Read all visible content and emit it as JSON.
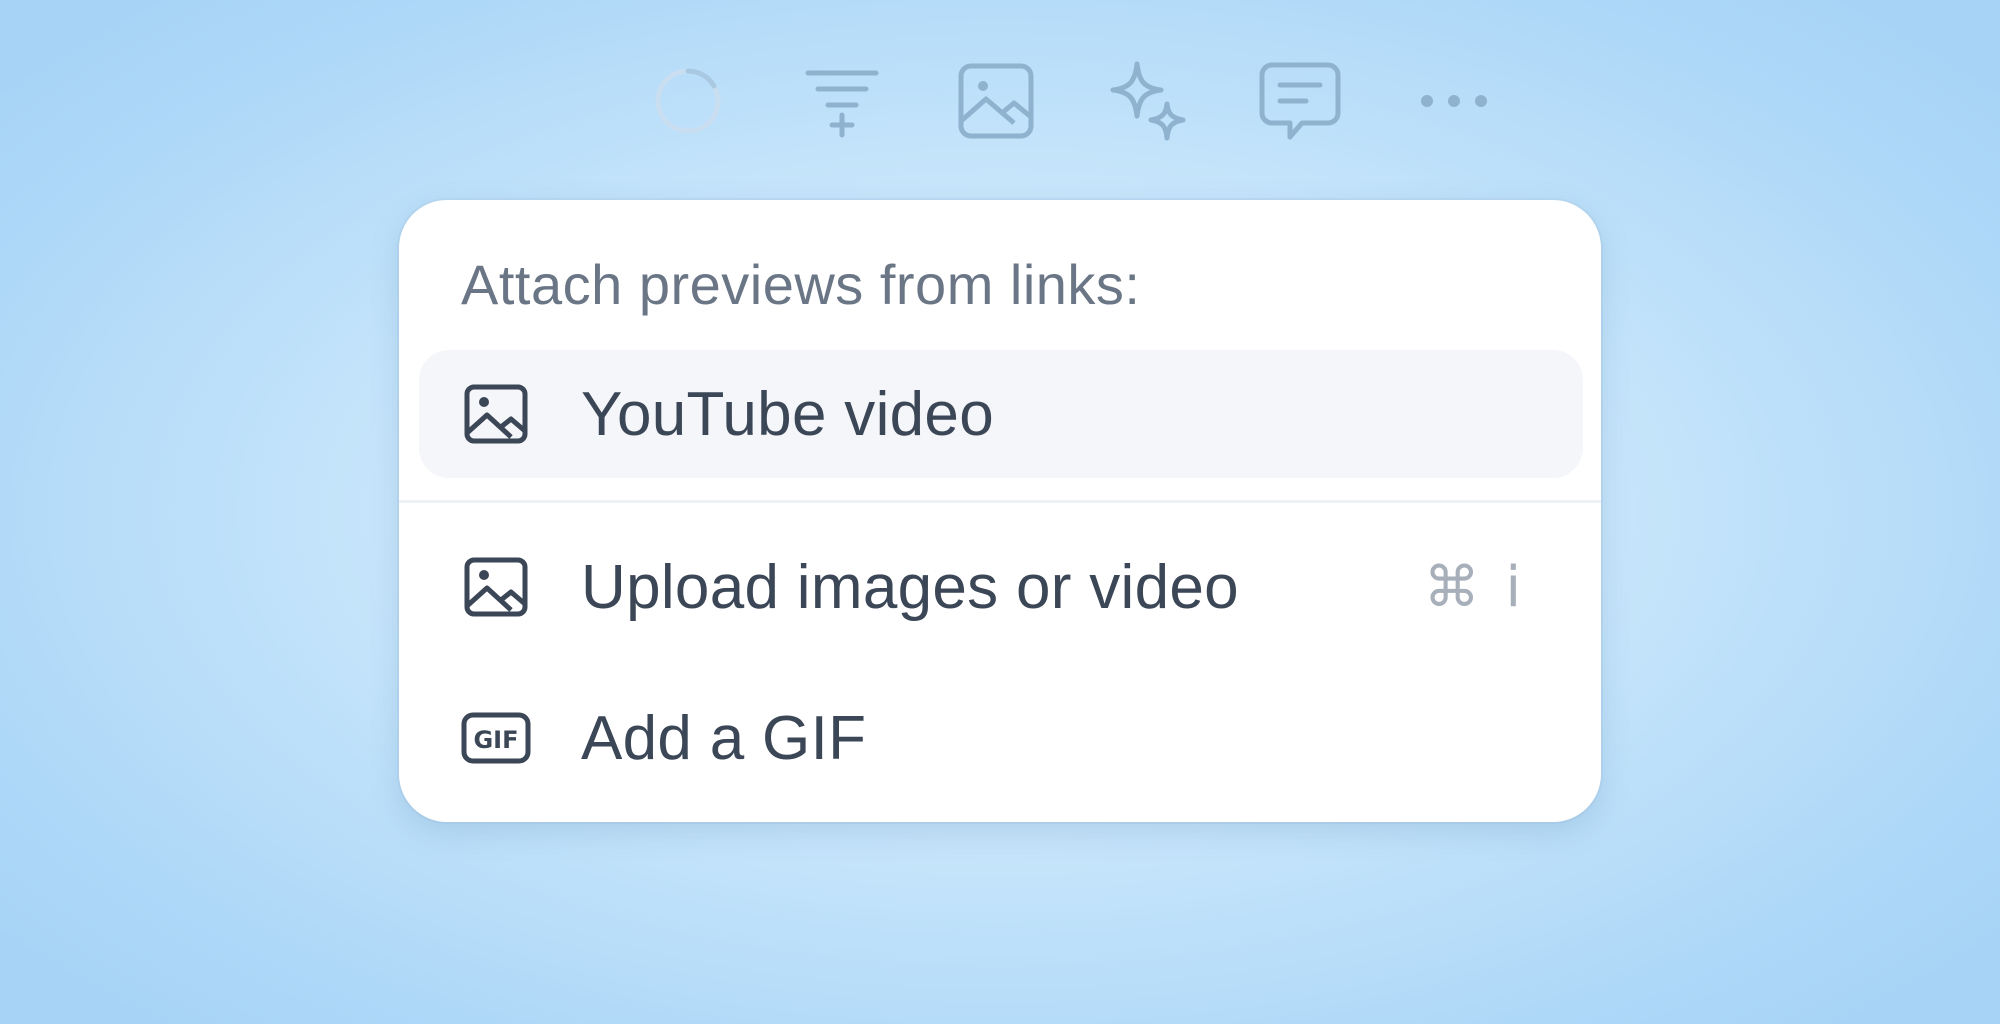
{
  "toolbar": {
    "items": [
      {
        "icon": "loading-spinner-icon"
      },
      {
        "icon": "filter-add-icon"
      },
      {
        "icon": "image-icon"
      },
      {
        "icon": "sparkle-icon"
      },
      {
        "icon": "comment-icon"
      },
      {
        "icon": "more-horizontal-icon"
      }
    ],
    "icon_color": "#8fb3cf"
  },
  "menu": {
    "header": "Attach previews from links:",
    "items": [
      {
        "label": "YouTube video",
        "icon": "image-icon",
        "highlighted": true
      },
      {
        "label": "Upload images or video",
        "icon": "image-icon",
        "shortcut": "⌘ i"
      },
      {
        "label": "Add a GIF",
        "icon": "gif-icon",
        "icon_text": "GIF"
      }
    ]
  },
  "colors": {
    "text_primary": "#3b4656",
    "text_secondary": "#6a7686",
    "shortcut": "#a7afba",
    "highlight": "#f4f6f9",
    "background": "#c8e6fb"
  }
}
